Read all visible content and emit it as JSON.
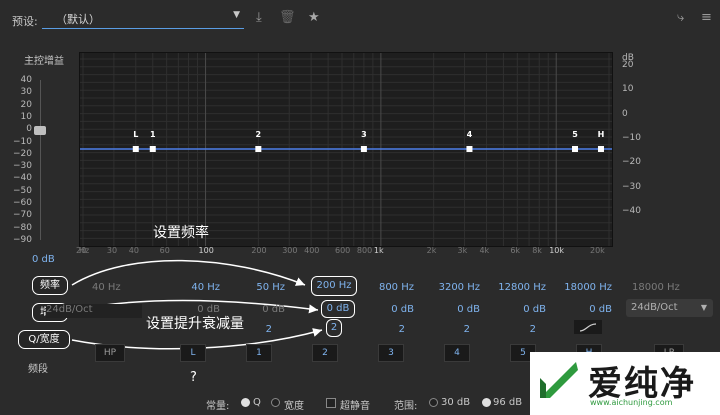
{
  "toolbar": {
    "preset_label": "预设:",
    "preset_value": "（默认）",
    "icons": [
      "save-preset-icon",
      "delete-preset-icon",
      "favorite-star-icon",
      "routing-icon",
      "more-icon"
    ]
  },
  "master_gain": {
    "label": "主控增益",
    "ticks": [
      "40",
      "30",
      "20",
      "10",
      "0",
      "−10",
      "−20",
      "−30",
      "−40",
      "−50",
      "−60",
      "−70",
      "−80",
      "−90"
    ],
    "value": "0 dB"
  },
  "graph": {
    "db_axis_unit": "dB",
    "db_ticks": [
      "20",
      "10",
      "0",
      "−10",
      "−20",
      "−30",
      "−40"
    ],
    "freq_ticks": [
      "Hz",
      "20",
      "30",
      "40",
      "60",
      "100",
      "200",
      "300",
      "400",
      "600",
      "800",
      "1k",
      "2k",
      "3k",
      "4k",
      "6k",
      "8k",
      "10k",
      "20k"
    ],
    "bands": [
      {
        "label": "L",
        "freq_hz": 40
      },
      {
        "label": "1",
        "freq_hz": 50
      },
      {
        "label": "2",
        "freq_hz": 200
      },
      {
        "label": "3",
        "freq_hz": 800
      },
      {
        "label": "4",
        "freq_hz": 3200
      },
      {
        "label": "5",
        "freq_hz": 12800
      },
      {
        "label": "H",
        "freq_hz": 18000
      }
    ],
    "curve_gain_db": 0,
    "curve_color": "#4d7ee8"
  },
  "rows": {
    "freq_label": "频率",
    "gain_label": "增益",
    "q_label": "Q/宽度",
    "band_label": "频段",
    "freq_values": [
      "40 Hz",
      "40 Hz",
      "50 Hz",
      "200 Hz",
      "800 Hz",
      "3200 Hz",
      "12800 Hz",
      "18000 Hz",
      "18000 Hz"
    ],
    "gain_values": [
      "24dB/Oct",
      "0 dB",
      "0 dB",
      "0 dB",
      "0 dB",
      "0 dB",
      "0 dB",
      "0 dB",
      "24dB/Oct"
    ],
    "q_values": [
      "2",
      "2",
      "2",
      "2",
      "2",
      "2"
    ],
    "band_buttons": [
      "HP",
      "L",
      "1",
      "2",
      "3",
      "4",
      "5",
      "H",
      "LP"
    ]
  },
  "annotations": {
    "set_frequency": "设置频率",
    "set_boost_cut": "设置提升衰减量",
    "question": "?"
  },
  "footer": {
    "constant_label": "常量:",
    "q_option": "Q",
    "width_option": "宽度",
    "ultra_quiet": "超静音",
    "range_label": "范围:",
    "range_30": "30 dB",
    "range_96": "96 dB"
  },
  "watermark": {
    "brand": "爱纯净",
    "url": "www.aichunjing.com"
  }
}
